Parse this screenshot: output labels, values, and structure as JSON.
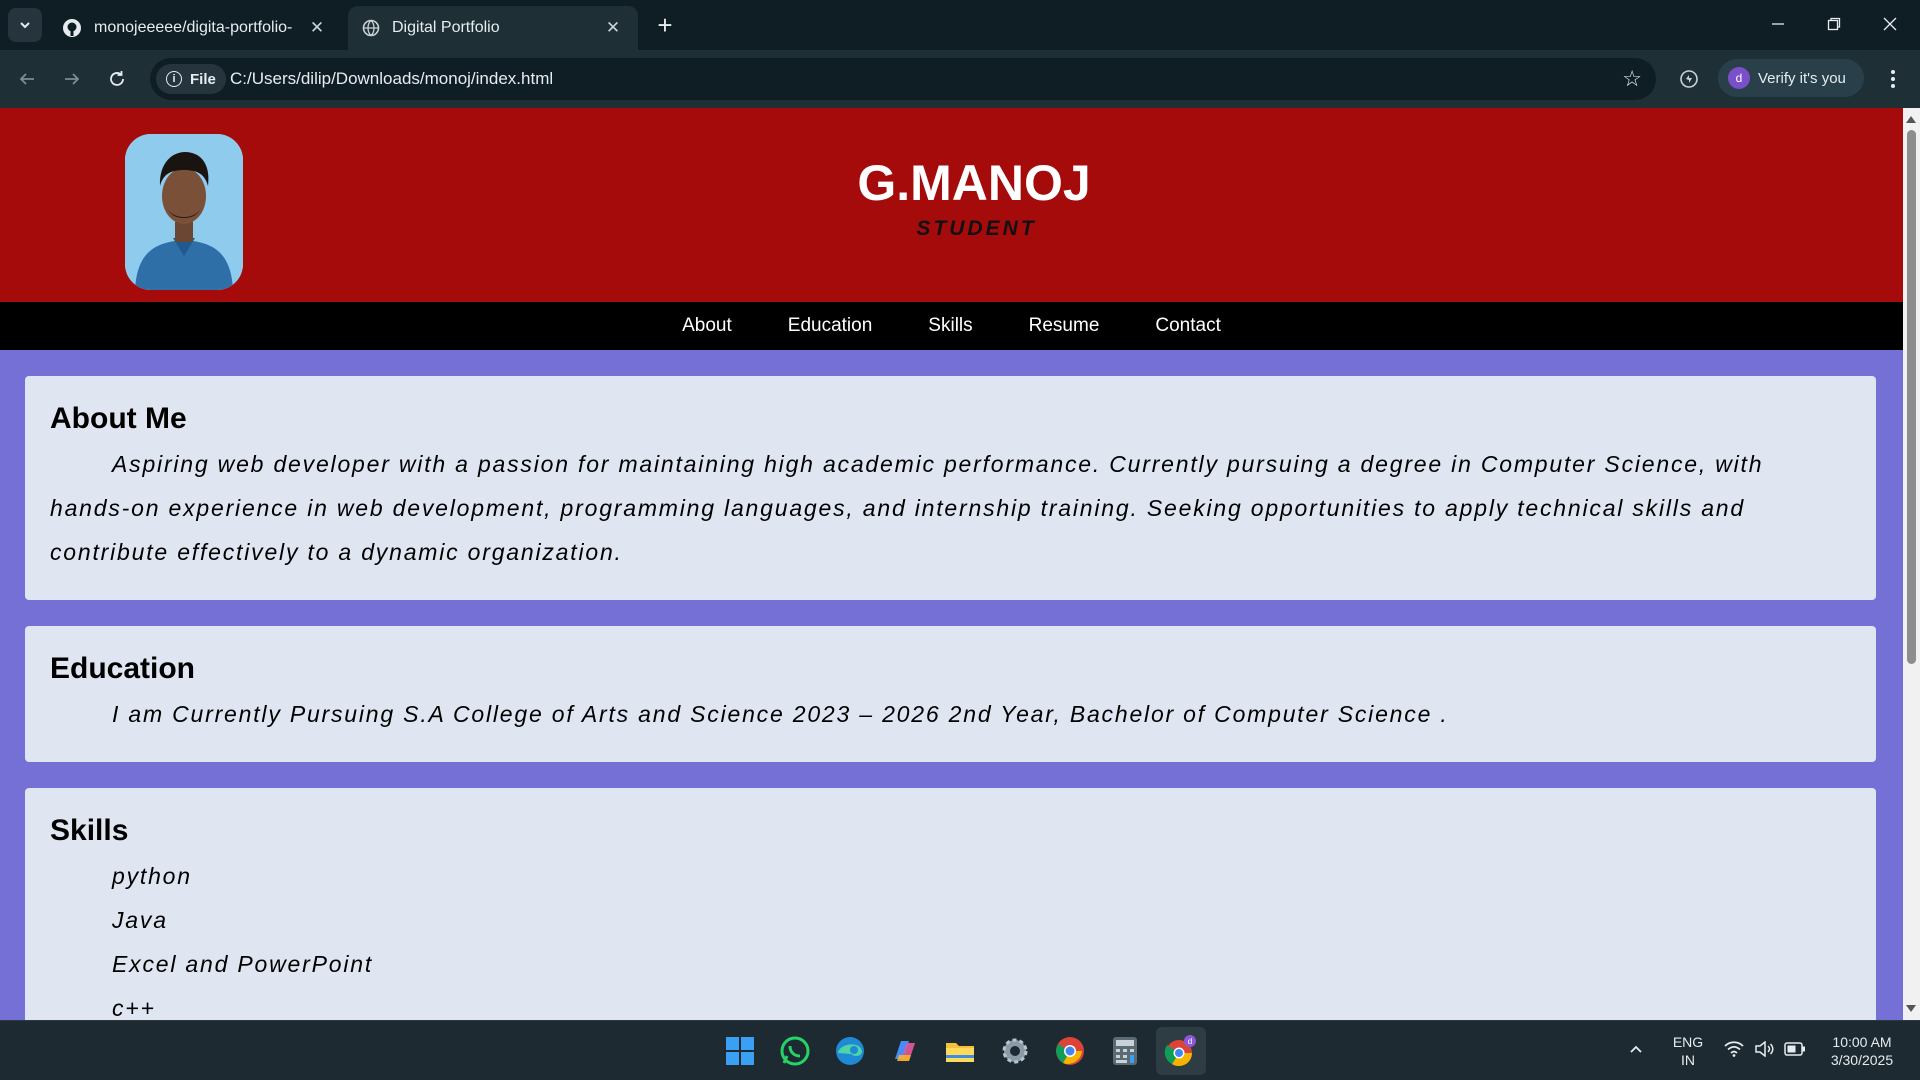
{
  "browser": {
    "tabs": [
      {
        "title": "monojeeeee/digita-portfolio-",
        "icon": "github-icon",
        "active": false
      },
      {
        "title": "Digital Portfolio",
        "icon": "globe-icon",
        "active": true
      }
    ],
    "address": {
      "chip_label": "File",
      "url": "C:/Users/dilip/Downloads/monoj/index.html"
    },
    "profile": {
      "avatar_letter": "d",
      "label": "Verify it's you"
    }
  },
  "page": {
    "header": {
      "name": "G.MANOJ",
      "role": "STUDENT"
    },
    "nav": [
      "About",
      "Education",
      "Skills",
      "Resume",
      "Contact"
    ],
    "about": {
      "heading": "About Me",
      "text": "Aspiring web developer with a passion for maintaining high academic performance. Currently pursuing a degree in Computer Science, with hands-on experience in web development, programming languages, and internship training. Seeking opportunities to apply technical skills and contribute effectively to a dynamic organization."
    },
    "education": {
      "heading": "Education",
      "text": "I am Currently Pursuing S.A College of Arts and Science 2023 – 2026 2nd Year, Bachelor of Computer Science ."
    },
    "skills": {
      "heading": "Skills",
      "items": [
        "python",
        "Java",
        "Excel and PowerPoint",
        "c++"
      ]
    }
  },
  "taskbar": {
    "apps": [
      "windows-start-icon",
      "whatsapp-icon",
      "edge-icon",
      "copilot-icon",
      "file-explorer-icon",
      "settings-icon",
      "chrome-icon",
      "calculator-icon",
      "chrome-profile-icon"
    ],
    "language": {
      "line1": "ENG",
      "line2": "IN"
    },
    "clock": {
      "time": "10:00 AM",
      "date": "3/30/2025"
    }
  },
  "colors": {
    "header_bg": "#a50b0b",
    "nav_bg": "#000000",
    "page_bg": "#7470d6",
    "card_bg": "#dfe6f2"
  }
}
